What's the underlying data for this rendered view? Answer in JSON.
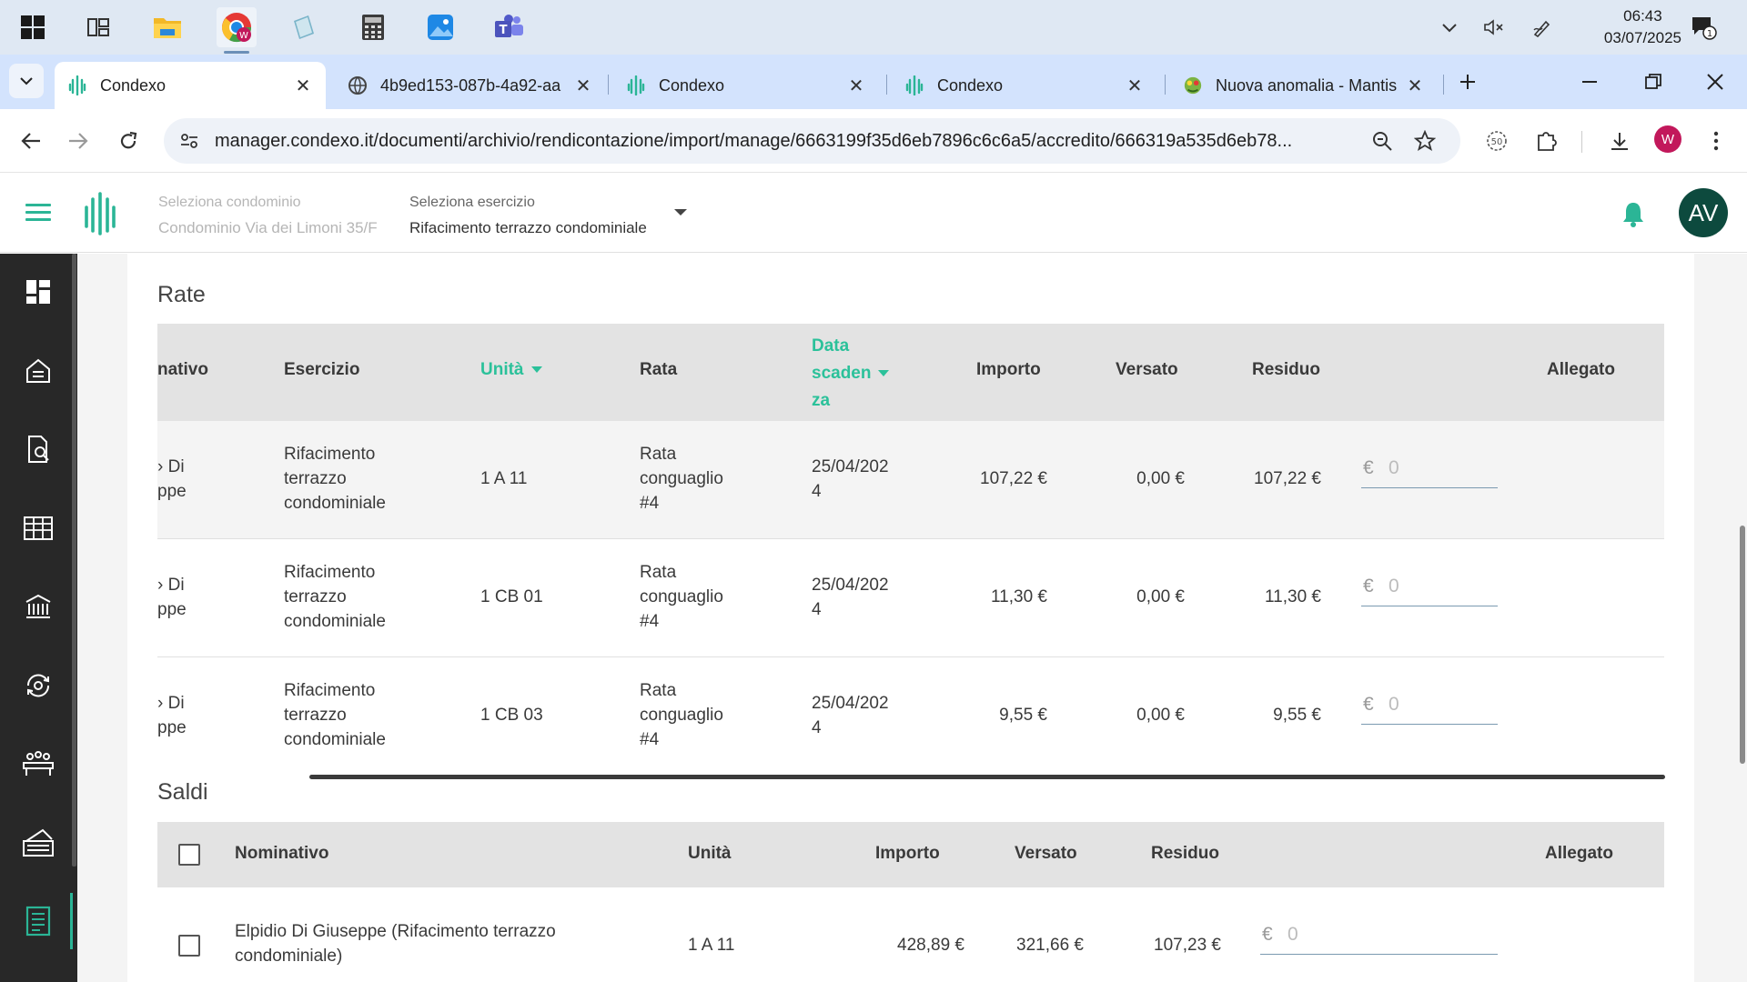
{
  "taskbar": {
    "apps": [
      "windows-start",
      "task-view",
      "file-explorer",
      "chrome",
      "notepad",
      "calculator",
      "photos",
      "teams"
    ],
    "clock_time": "06:43",
    "clock_date": "03/07/2025",
    "notification_count": "1"
  },
  "browser": {
    "tabs": [
      {
        "title": "Condexo",
        "active": true
      },
      {
        "title": "4b9ed153-087b-4a92-aa",
        "active": false
      },
      {
        "title": "Condexo",
        "active": false
      },
      {
        "title": "Condexo",
        "active": false
      },
      {
        "title": "Nuova anomalia - Mantis",
        "active": false
      }
    ],
    "url": "manager.condexo.it/documenti/archivio/rendicontazione/import/manage/6663199f35d6eb7896c6c6a5/accredito/666319a535d6eb78...",
    "profile_initial": "W"
  },
  "header": {
    "condominio_label": "Seleziona condominio",
    "condominio_value": "Condominio Via dei Limoni 35/F",
    "esercizio_label": "Seleziona esercizio",
    "esercizio_value": "Rifacimento terrazzo condominiale",
    "avatar_initials": "AV",
    "accent_color": "#2bb596"
  },
  "sidebar": {
    "items": [
      "dashboard-icon",
      "building-icon",
      "document-search-icon",
      "table-icon",
      "bank-icon",
      "sync-icon",
      "meeting-icon",
      "payment-icon",
      "receipt-icon"
    ],
    "active_index": 8
  },
  "rate": {
    "title": "Rate",
    "columns": {
      "nominativo": "nativo",
      "esercizio": "Esercizio",
      "unita": "Unità",
      "rata": "Rata",
      "data_l1": "Data",
      "data_l2": "scaden",
      "data_l3": "za",
      "importo": "Importo",
      "versato": "Versato",
      "residuo": "Residuo",
      "allegato": "Allegato"
    },
    "rows": [
      {
        "nom_l1": "› Di",
        "nom_l2": "ppe",
        "es_l1": "Rifacimento",
        "es_l2": "terrazzo",
        "es_l3": "condominiale",
        "unita": "1 A 11",
        "rata_l1": "Rata",
        "rata_l2": "conguaglio",
        "rata_l3": "#4",
        "data_l1": "25/04/202",
        "data_l2": "4",
        "importo": "107,22 €",
        "versato": "0,00 €",
        "residuo": "107,22 €",
        "euro": "€",
        "input_placeholder": "0"
      },
      {
        "nom_l1": "› Di",
        "nom_l2": "ppe",
        "es_l1": "Rifacimento",
        "es_l2": "terrazzo",
        "es_l3": "condominiale",
        "unita": "1 CB 01",
        "rata_l1": "Rata",
        "rata_l2": "conguaglio",
        "rata_l3": "#4",
        "data_l1": "25/04/202",
        "data_l2": "4",
        "importo": "11,30 €",
        "versato": "0,00 €",
        "residuo": "11,30 €",
        "euro": "€",
        "input_placeholder": "0"
      },
      {
        "nom_l1": "› Di",
        "nom_l2": "ppe",
        "es_l1": "Rifacimento",
        "es_l2": "terrazzo",
        "es_l3": "condominiale",
        "unita": "1 CB 03",
        "rata_l1": "Rata",
        "rata_l2": "conguaglio",
        "rata_l3": "#4",
        "data_l1": "25/04/202",
        "data_l2": "4",
        "importo": "9,55 €",
        "versato": "0,00 €",
        "residuo": "9,55 €",
        "euro": "€",
        "input_placeholder": "0"
      }
    ]
  },
  "saldi": {
    "title": "Saldi",
    "columns": {
      "nominativo": "Nominativo",
      "unita": "Unità",
      "importo": "Importo",
      "versato": "Versato",
      "residuo": "Residuo",
      "allegato": "Allegato"
    },
    "rows": [
      {
        "nom_l1": "Elpidio Di Giuseppe (Rifacimento terrazzo",
        "nom_l2": "condominiale)",
        "unita": "1 A 11",
        "importo": "428,89 €",
        "versato": "321,66 €",
        "residuo": "107,23 €",
        "euro": "€",
        "input_placeholder": "0"
      }
    ]
  }
}
